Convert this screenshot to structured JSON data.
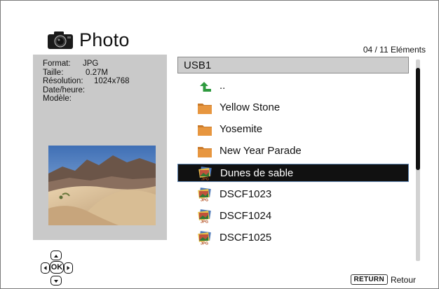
{
  "header": {
    "title": "Photo",
    "icon": "camera-icon"
  },
  "counter": "04 / 11 Eléments",
  "info": {
    "rows": [
      {
        "label": "Format:",
        "value": "JPG"
      },
      {
        "label": "Taille:",
        "value": "0.27M"
      },
      {
        "label": "Résolution:",
        "value": "1024x768"
      },
      {
        "label": "Date/heure:",
        "value": ""
      },
      {
        "label": "Modèle:",
        "value": ""
      }
    ]
  },
  "list": {
    "header": "USB1",
    "items": [
      {
        "label": "..",
        "icon": "up-arrow-icon"
      },
      {
        "label": "Yellow Stone",
        "icon": "folder-icon"
      },
      {
        "label": "Yosemite",
        "icon": "folder-icon"
      },
      {
        "label": "New Year Parade",
        "icon": "folder-icon"
      },
      {
        "label": "Dunes de sable",
        "icon": "jpg-file-icon",
        "selected": true
      },
      {
        "label": "DSCF1023",
        "icon": "jpg-file-icon"
      },
      {
        "label": "DSCF1024",
        "icon": "jpg-file-icon"
      },
      {
        "label": "DSCF1025",
        "icon": "jpg-file-icon"
      }
    ]
  },
  "nav": {
    "ok_label": "OK"
  },
  "footer": {
    "return_button": "RETURN",
    "return_label": "Retour"
  },
  "colors": {
    "panel": "#c9c9c9",
    "selection": "#111111",
    "folder": "#e0913a",
    "up_arrow": "#2e9a3e"
  }
}
